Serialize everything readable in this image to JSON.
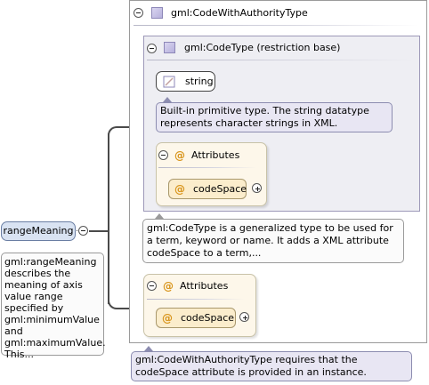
{
  "element": {
    "name": "rangeMeaning",
    "annotation": "gml:rangeMeaning describes the meaning of axis value range specified by gml:minimumValue and gml:maximumValue. This..."
  },
  "complex_type": {
    "name": "gml:CodeWithAuthorityType",
    "annotation": "gml:CodeWithAuthorityType requires that the codeSpace attribute is provided in an instance."
  },
  "base_type": {
    "name": "gml:CodeType (restriction base)",
    "primitive_name": "string",
    "primitive_annotation": "Built-in primitive type. The string datatype represents character strings in XML.",
    "annotation": "gml:CodeType is a generalized type to be used for a term, keyword or name. It adds a XML attribute codeSpace to a term,..."
  },
  "attributes_inner": {
    "label": "Attributes",
    "icon": "@",
    "attribute": "codeSpace"
  },
  "attributes_outer": {
    "label": "Attributes",
    "icon": "@",
    "attribute": "codeSpace"
  }
}
